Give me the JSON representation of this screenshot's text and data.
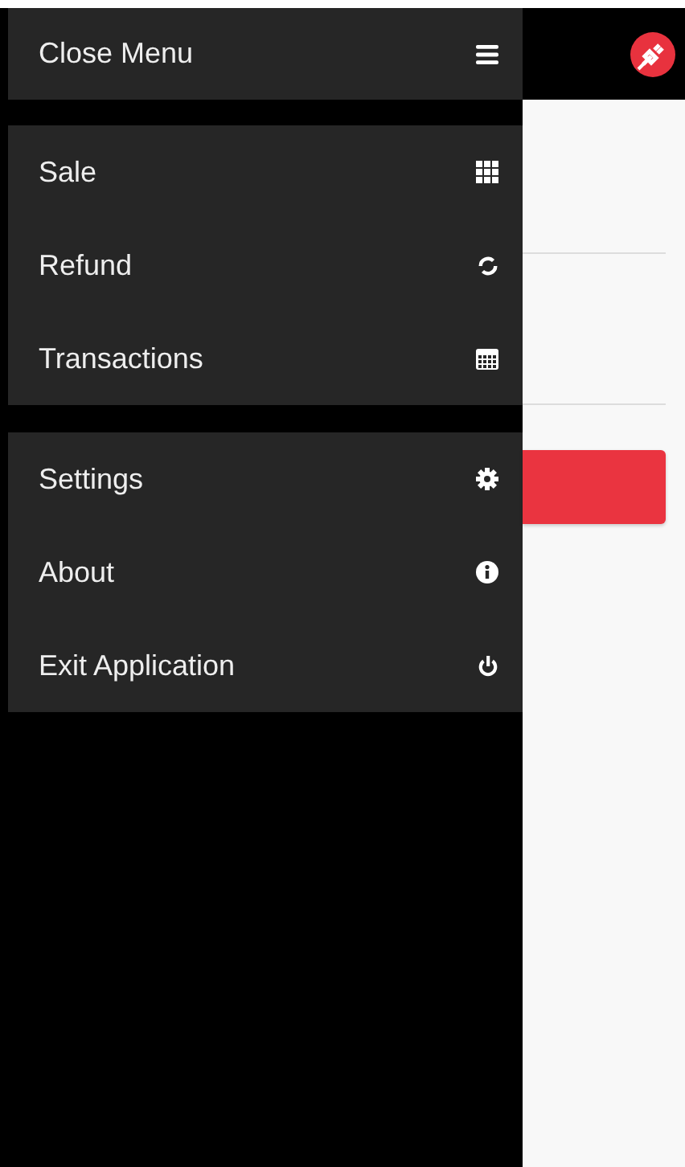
{
  "menu": {
    "close_label": "Close Menu",
    "groups": [
      [
        {
          "label": "Sale"
        },
        {
          "label": "Refund"
        },
        {
          "label": "Transactions"
        }
      ],
      [
        {
          "label": "Settings"
        },
        {
          "label": "About"
        },
        {
          "label": "Exit Application"
        }
      ]
    ]
  }
}
